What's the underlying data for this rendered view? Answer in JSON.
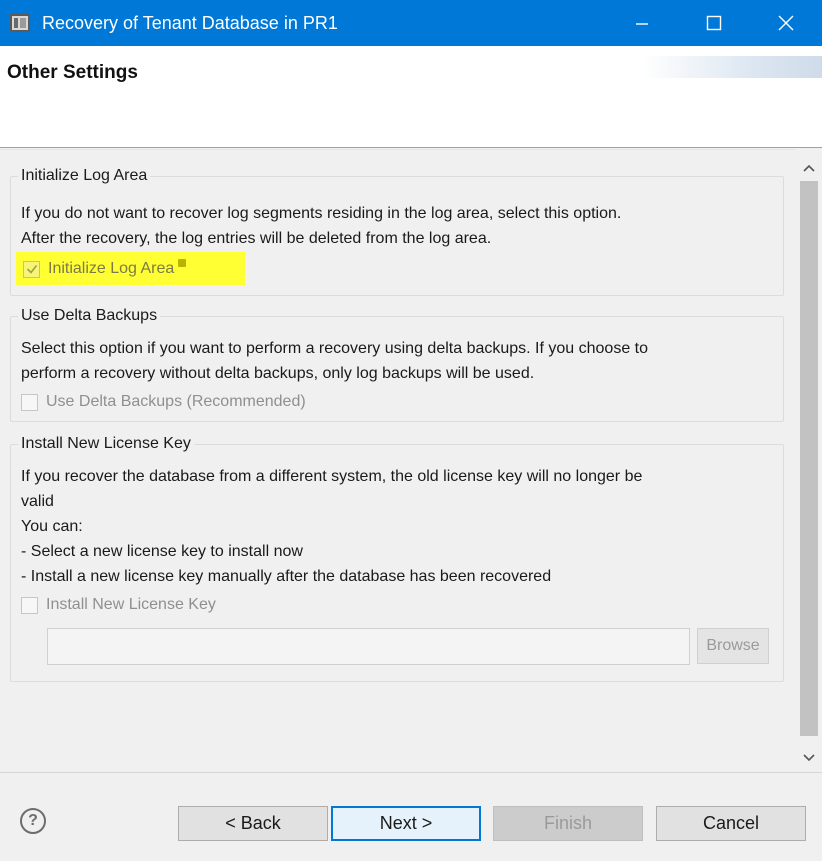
{
  "window": {
    "title": "Recovery of Tenant Database in PR1",
    "accent_color": "#0078d7"
  },
  "header": {
    "title": "Other Settings"
  },
  "groups": {
    "log_area": {
      "label": "Initialize Log Area",
      "text_line1": "If you do not want to recover log segments residing in the log area, select this option.",
      "text_line2": "After the recovery, the log entries will be deleted from the log area.",
      "checkbox_label": "Initialize Log Area",
      "checked": true,
      "highlight_color": "#ffff33"
    },
    "delta_backups": {
      "label": "Use Delta Backups",
      "text_line1": "Select this option if you want to perform a recovery using delta backups. If you choose to",
      "text_line2": "perform a recovery without delta backups, only log backups will be used.",
      "checkbox_label": "Use Delta Backups (Recommended)",
      "checked": false
    },
    "license_key": {
      "label": "Install New License Key",
      "text_line1": "If you recover the database from a different system, the old license key will no longer be",
      "text_line2": "valid",
      "text_line3": "You can:",
      "text_line4": "- Select a new license key to install now",
      "text_line5": "- Install a new license key manually after the database has been recovered",
      "checkbox_label": "Install New License Key",
      "checked": false,
      "input_value": "",
      "browse_label": "Browse"
    }
  },
  "footer": {
    "help_icon": "help-icon",
    "back_label": "< Back",
    "next_label": "Next >",
    "finish_label": "Finish",
    "cancel_label": "Cancel"
  }
}
